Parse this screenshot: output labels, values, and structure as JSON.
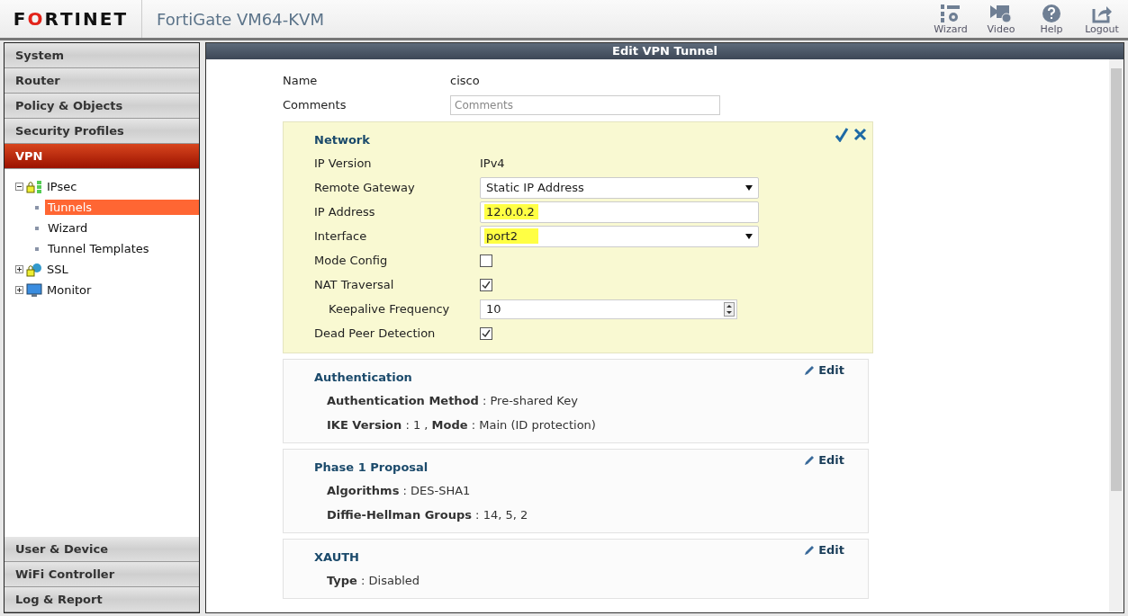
{
  "header": {
    "logo": "FORTINET",
    "product": "FortiGate VM64-KVM",
    "tools": [
      {
        "kind": "wizard",
        "label": "Wizard"
      },
      {
        "kind": "video",
        "label": "Video"
      },
      {
        "kind": "help",
        "label": "Help"
      },
      {
        "kind": "logout",
        "label": "Logout"
      }
    ]
  },
  "sidebar": {
    "top_sections": [
      {
        "label": "System",
        "selected": false
      },
      {
        "label": "Router",
        "selected": false
      },
      {
        "label": "Policy & Objects",
        "selected": false
      },
      {
        "label": "Security Profiles",
        "selected": false
      },
      {
        "label": "VPN",
        "selected": true
      }
    ],
    "tree": [
      {
        "label": "IPsec",
        "kind": "ipsec",
        "expanded": true,
        "children": [
          {
            "label": "Tunnels",
            "selected": true
          },
          {
            "label": "Wizard",
            "selected": false
          },
          {
            "label": "Tunnel Templates",
            "selected": false
          }
        ]
      },
      {
        "label": "SSL",
        "kind": "ssl",
        "expanded": false
      },
      {
        "label": "Monitor",
        "kind": "monitor",
        "expanded": false
      }
    ],
    "bottom_sections": [
      {
        "label": "User & Device",
        "selected": false
      },
      {
        "label": "WiFi Controller",
        "selected": false
      },
      {
        "label": "Log & Report",
        "selected": false
      }
    ]
  },
  "panel": {
    "title": "Edit VPN Tunnel",
    "name": {
      "label": "Name",
      "value": "cisco"
    },
    "comments": {
      "label": "Comments",
      "placeholder": "Comments"
    },
    "network": {
      "title": "Network",
      "fields": [
        {
          "kind": "text",
          "label": "IP Version",
          "value": "IPv4"
        },
        {
          "kind": "select",
          "label": "Remote Gateway",
          "value": "Static IP Address",
          "highlighted": false
        },
        {
          "kind": "input",
          "label": "IP Address",
          "value": "12.0.0.2",
          "highlighted": true
        },
        {
          "kind": "select",
          "label": "Interface",
          "value": "port2",
          "highlighted": true
        },
        {
          "kind": "checkbox",
          "label": "Mode Config",
          "checked": false
        },
        {
          "kind": "checkbox",
          "label": "NAT Traversal",
          "checked": true
        },
        {
          "kind": "spinner",
          "label": "Keepalive Frequency",
          "value": "10",
          "indented": true
        },
        {
          "kind": "checkbox",
          "label": "Dead Peer Detection",
          "checked": true
        }
      ]
    },
    "summaries": [
      {
        "title": "Authentication",
        "edit": "Edit",
        "lines": [
          "**Authentication Method** : Pre-shared Key",
          "**IKE Version** : 1 , **Mode** : Main (ID protection)"
        ]
      },
      {
        "title": "Phase 1 Proposal",
        "edit": "Edit",
        "lines": [
          "**Algorithms** : DES-SHA1",
          "**Diffie-Hellman Groups** : 14, 5, 2"
        ]
      },
      {
        "title": "XAUTH",
        "edit": "Edit",
        "lines": [
          "**Type** : Disabled"
        ]
      }
    ]
  }
}
